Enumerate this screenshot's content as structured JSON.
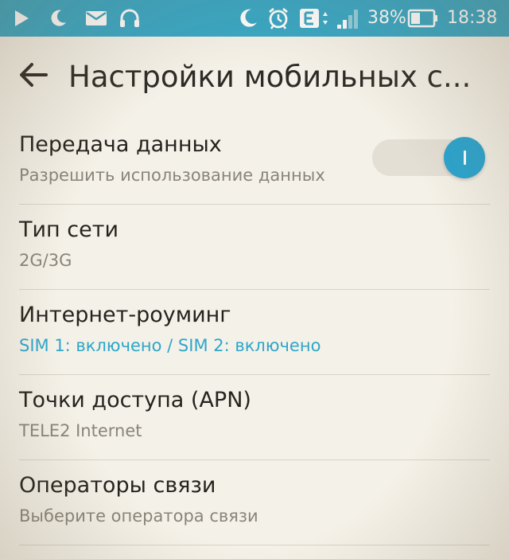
{
  "status_bar": {
    "battery_percent": "38%",
    "time": "18:38",
    "network_type": "E",
    "signal_level": 0.5,
    "battery_level": 0.38,
    "icons": [
      "play-icon",
      "moon-icon",
      "mail-icon",
      "headset-icon",
      "do-not-disturb-icon",
      "alarm-icon",
      "network-type-icon",
      "signal-icon",
      "battery-icon"
    ]
  },
  "toolbar": {
    "back_icon": "arrow-left-icon",
    "title": "Настройки мобильных с..."
  },
  "settings": [
    {
      "title": "Передача данных",
      "summary": "Разрешить использование данных",
      "has_toggle": true,
      "toggle_on": true
    },
    {
      "title": "Тип сети",
      "summary": "2G/3G"
    },
    {
      "title": "Интернет-роуминг",
      "summary": "SIM 1: включено / SIM 2: включено",
      "accent": true
    },
    {
      "title": "Точки доступа (APN)",
      "summary": "TELE2 Internet"
    },
    {
      "title": "Операторы связи",
      "summary": "Выберите оператора связи"
    }
  ],
  "colors": {
    "status_bar": "#38a7c5",
    "accent": "#2aa4cf",
    "background": "#f4f1e8",
    "title_text": "#26231f",
    "summary_text": "#8a847a"
  }
}
